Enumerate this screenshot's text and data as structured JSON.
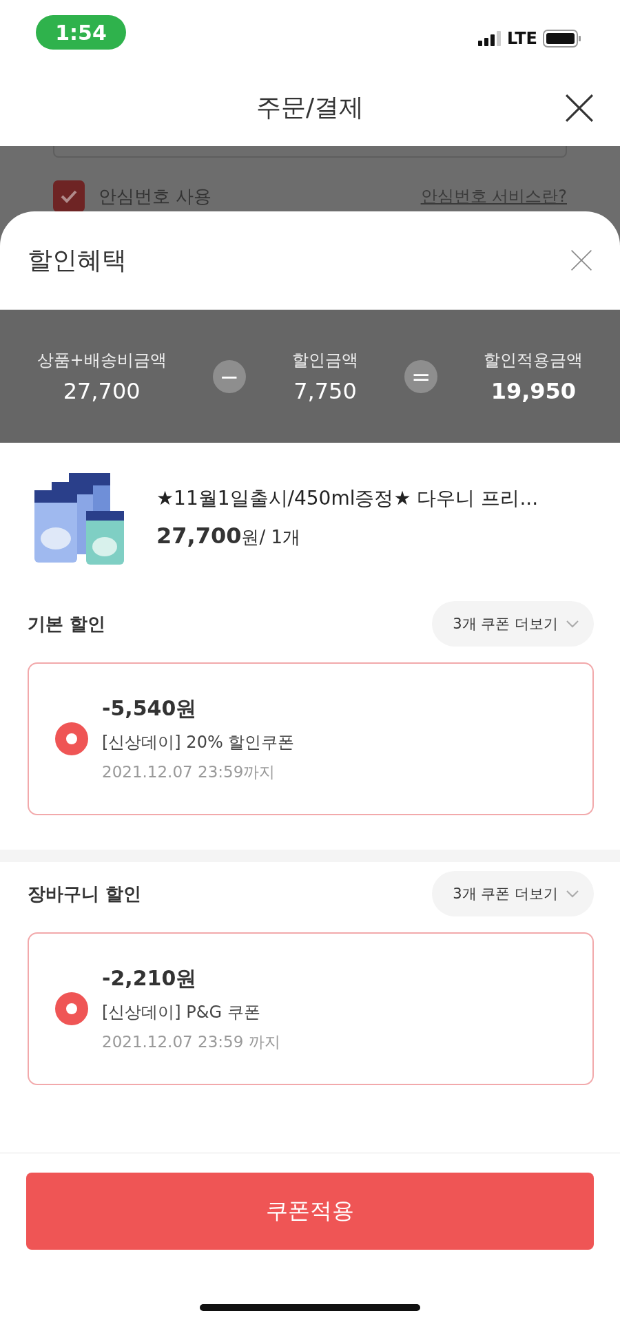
{
  "status_bar": {
    "time": "1:54",
    "network": "LTE"
  },
  "header": {
    "title": "주문/결제"
  },
  "background": {
    "checkbox": {
      "label": "안심번호 사용",
      "checked": true
    },
    "link": "안심번호 서비스란?"
  },
  "sheet": {
    "title": "할인혜택",
    "summary": [
      {
        "label": "상품+배송비금액",
        "value": "27,700",
        "emphasis": false,
        "operator": "−"
      },
      {
        "label": "할인금액",
        "value": "7,750",
        "emphasis": false,
        "operator": "="
      },
      {
        "label": "할인적용금액",
        "value": "19,950",
        "emphasis": true
      }
    ],
    "product": {
      "title": "★11월1일출시/450ml증정★ 다우니 프리...",
      "price": "**27,700**원/ 1개"
    },
    "sections": [
      {
        "title": "기본 할인",
        "more": "3개 쿠폰 더보기",
        "coupons": [
          {
            "amount": "-5,540원",
            "name": "[신상데이] 20% 할인쿠폰",
            "expiry": "2021.12.07 23:59까지",
            "selected": true
          }
        ]
      },
      {
        "title": "장바구니 할인",
        "more": "3개 쿠폰 더보기",
        "coupons": [
          {
            "amount": "-2,210원",
            "name": "[신상데이] P&G 쿠폰",
            "expiry": "2021.12.07 23:59 까지",
            "selected": true
          }
        ]
      }
    ],
    "apply_button": "쿠폰적용"
  }
}
